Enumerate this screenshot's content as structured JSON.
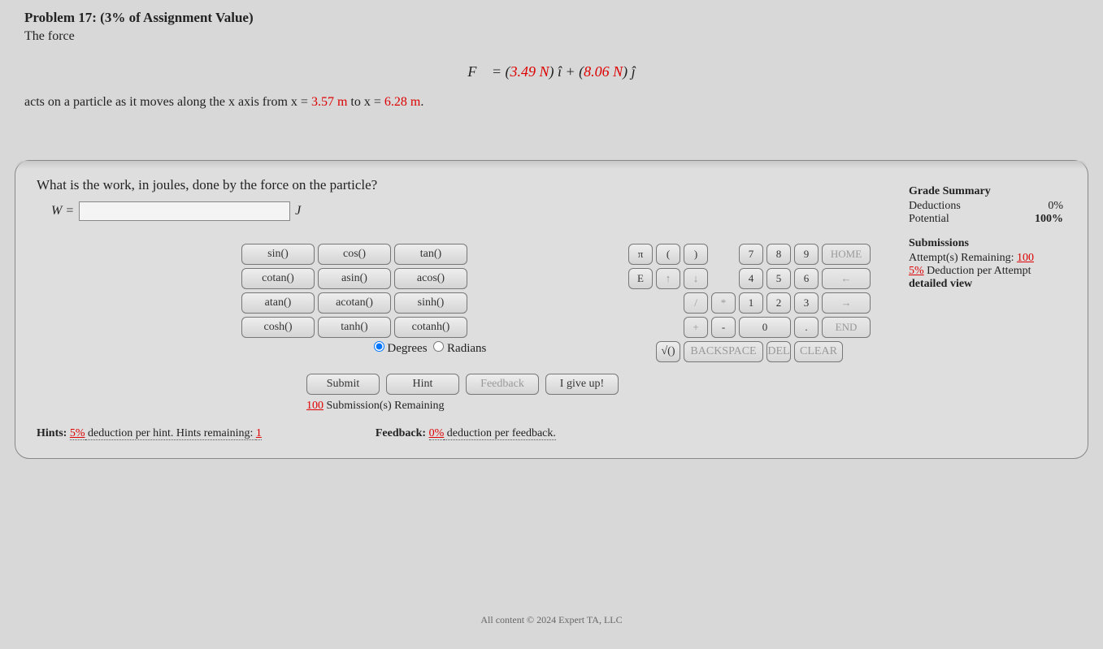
{
  "problem": {
    "title": "Problem 17: (3% of Assignment Value)",
    "intro": "The force",
    "eq_prefix": "F⃗ = (",
    "eq_v1": "3.49 N",
    "eq_mid1": ") î + (",
    "eq_v2": "8.06 N",
    "eq_mid2": ") ĵ",
    "acts_prefix": "acts on a particle as it moves along the x axis from x = ",
    "x1": "3.57 m",
    "acts_mid": " to x = ",
    "x2": "6.28 m",
    "acts_suffix": "."
  },
  "question": "What is the work, in joules, done by the force on the particle?",
  "input": {
    "label": "W =",
    "value": "",
    "placeholder": "",
    "unit": "J"
  },
  "fn_buttons": [
    "sin()",
    "cos()",
    "tan()",
    "cotan()",
    "asin()",
    "acos()",
    "atan()",
    "acotan()",
    "sinh()",
    "cosh()",
    "tanh()",
    "cotanh()"
  ],
  "angle": {
    "degrees": "Degrees",
    "radians": "Radians"
  },
  "numpad": {
    "r1": [
      "π",
      "(",
      ")",
      "7",
      "8",
      "9",
      "HOME"
    ],
    "r2": [
      "E",
      "↑",
      "↓",
      "4",
      "5",
      "6",
      "←"
    ],
    "r3": [
      "/",
      "*",
      "1",
      "2",
      "3",
      "→"
    ],
    "r4": [
      "+",
      "-",
      "0",
      ".",
      "END"
    ],
    "r5": [
      "√()",
      "BACKSPACE",
      "DEL",
      "CLEAR"
    ]
  },
  "actions": {
    "submit": "Submit",
    "hint": "Hint",
    "feedback": "Feedback",
    "giveup": "I give up!",
    "submissions": "Submission(s) Remaining",
    "submissions_n": "100"
  },
  "hints": {
    "label": "Hints:",
    "pct": "5%",
    "text": " deduction per hint. Hints remaining: ",
    "remaining": "1"
  },
  "feedback_info": {
    "label": "Feedback:",
    "pct": "0%",
    "text": " deduction per feedback."
  },
  "grade": {
    "title": "Grade Summary",
    "deductions_label": "Deductions",
    "deductions_val": "0%",
    "potential_label": "Potential",
    "potential_val": "100%",
    "submissions_title": "Submissions",
    "attempts_label": "Attempt(s) Remaining: ",
    "attempts_val": "100",
    "deduction_label": " Deduction per Attempt",
    "deduction_pct": "5%",
    "detailed": "detailed view"
  },
  "footer": "All content © 2024 Expert TA, LLC"
}
